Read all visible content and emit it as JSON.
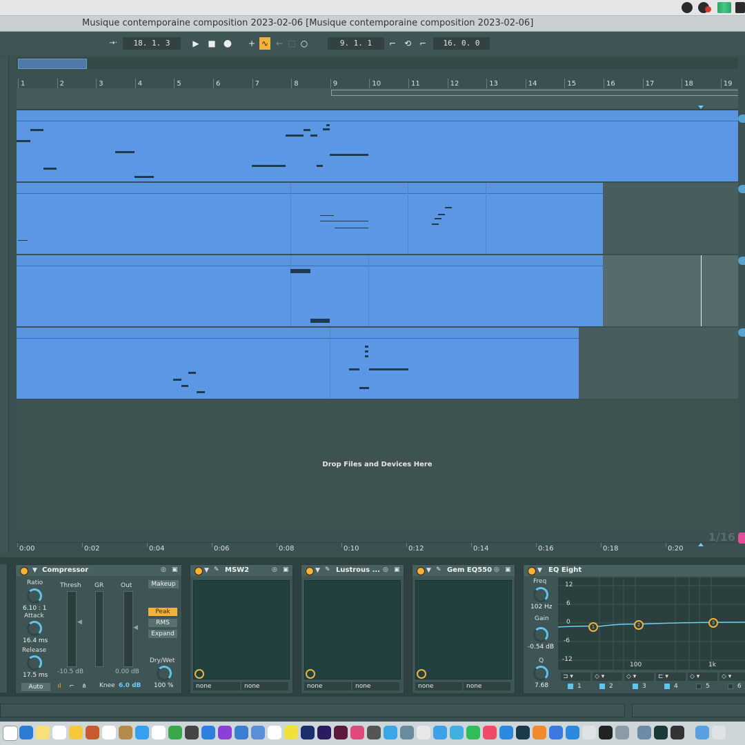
{
  "window": {
    "title": "Musique contemporaine composition 2023-02-06  [Musique contemporaine composition 2023-02-06]"
  },
  "transport": {
    "arrangement_position": "18.  1.  3",
    "loop_start": "9.  1.  1",
    "loop_length": "16.  0.  0",
    "play_icon": "play-icon",
    "stop_icon": "stop-icon",
    "record_icon": "record-icon"
  },
  "ruler": {
    "bars": [
      "1",
      "2",
      "3",
      "4",
      "5",
      "6",
      "7",
      "8",
      "9",
      "10",
      "11",
      "12",
      "13",
      "14",
      "15",
      "16",
      "17",
      "18",
      "19"
    ]
  },
  "time_ruler": {
    "labels": [
      "0:00",
      "0:02",
      "0:04",
      "0:06",
      "0:08",
      "0:10",
      "0:12",
      "0:14",
      "0:16",
      "0:18",
      "0:20"
    ]
  },
  "arrangement": {
    "drop_label": "Drop Files and Devices Here",
    "zoom_label": "1/16"
  },
  "devices": {
    "compressor": {
      "title": "Compressor",
      "ratio_label": "Ratio",
      "ratio_value": "6.10 : 1",
      "attack_label": "Attack",
      "attack_value": "16.4 ms",
      "release_label": "Release",
      "release_value": "17.5 ms",
      "auto_label": "Auto",
      "thresh_label": "Thresh",
      "gr_label": "GR",
      "out_label": "Out",
      "thresh_value": "-10.5 dB",
      "out_value": "0.00 dB",
      "makeup_label": "Makeup",
      "peak_label": "Peak",
      "rms_label": "RMS",
      "expand_label": "Expand",
      "drywet_label": "Dry/Wet",
      "drywet_value": "100 %",
      "knee_label": "Knee",
      "knee_value": "6.0 dB"
    },
    "msw2": {
      "title": "MSW2",
      "sel1": "none",
      "sel2": "none"
    },
    "lustrous": {
      "title": "Lustrous ...",
      "sel1": "none",
      "sel2": "none"
    },
    "gem": {
      "title": "Gem EQ550",
      "sel1": "none",
      "sel2": "none"
    },
    "eq8": {
      "title": "EQ Eight",
      "freq_label": "Freq",
      "freq_value": "102 Hz",
      "gain_label": "Gain",
      "gain_value": "-0.54 dB",
      "q_label": "Q",
      "q_value": "7.68",
      "db_labels": [
        "12",
        "6",
        "0",
        "-6",
        "-12"
      ],
      "hz_labels": [
        "100",
        "1k"
      ],
      "bands": [
        "1",
        "2",
        "3",
        "4",
        "5",
        "6"
      ],
      "points": [
        "1",
        "2",
        "3"
      ]
    }
  },
  "colors": {
    "clip": "#5b97e4",
    "accent": "#f5b23a",
    "knob": "#5fc4ef"
  }
}
